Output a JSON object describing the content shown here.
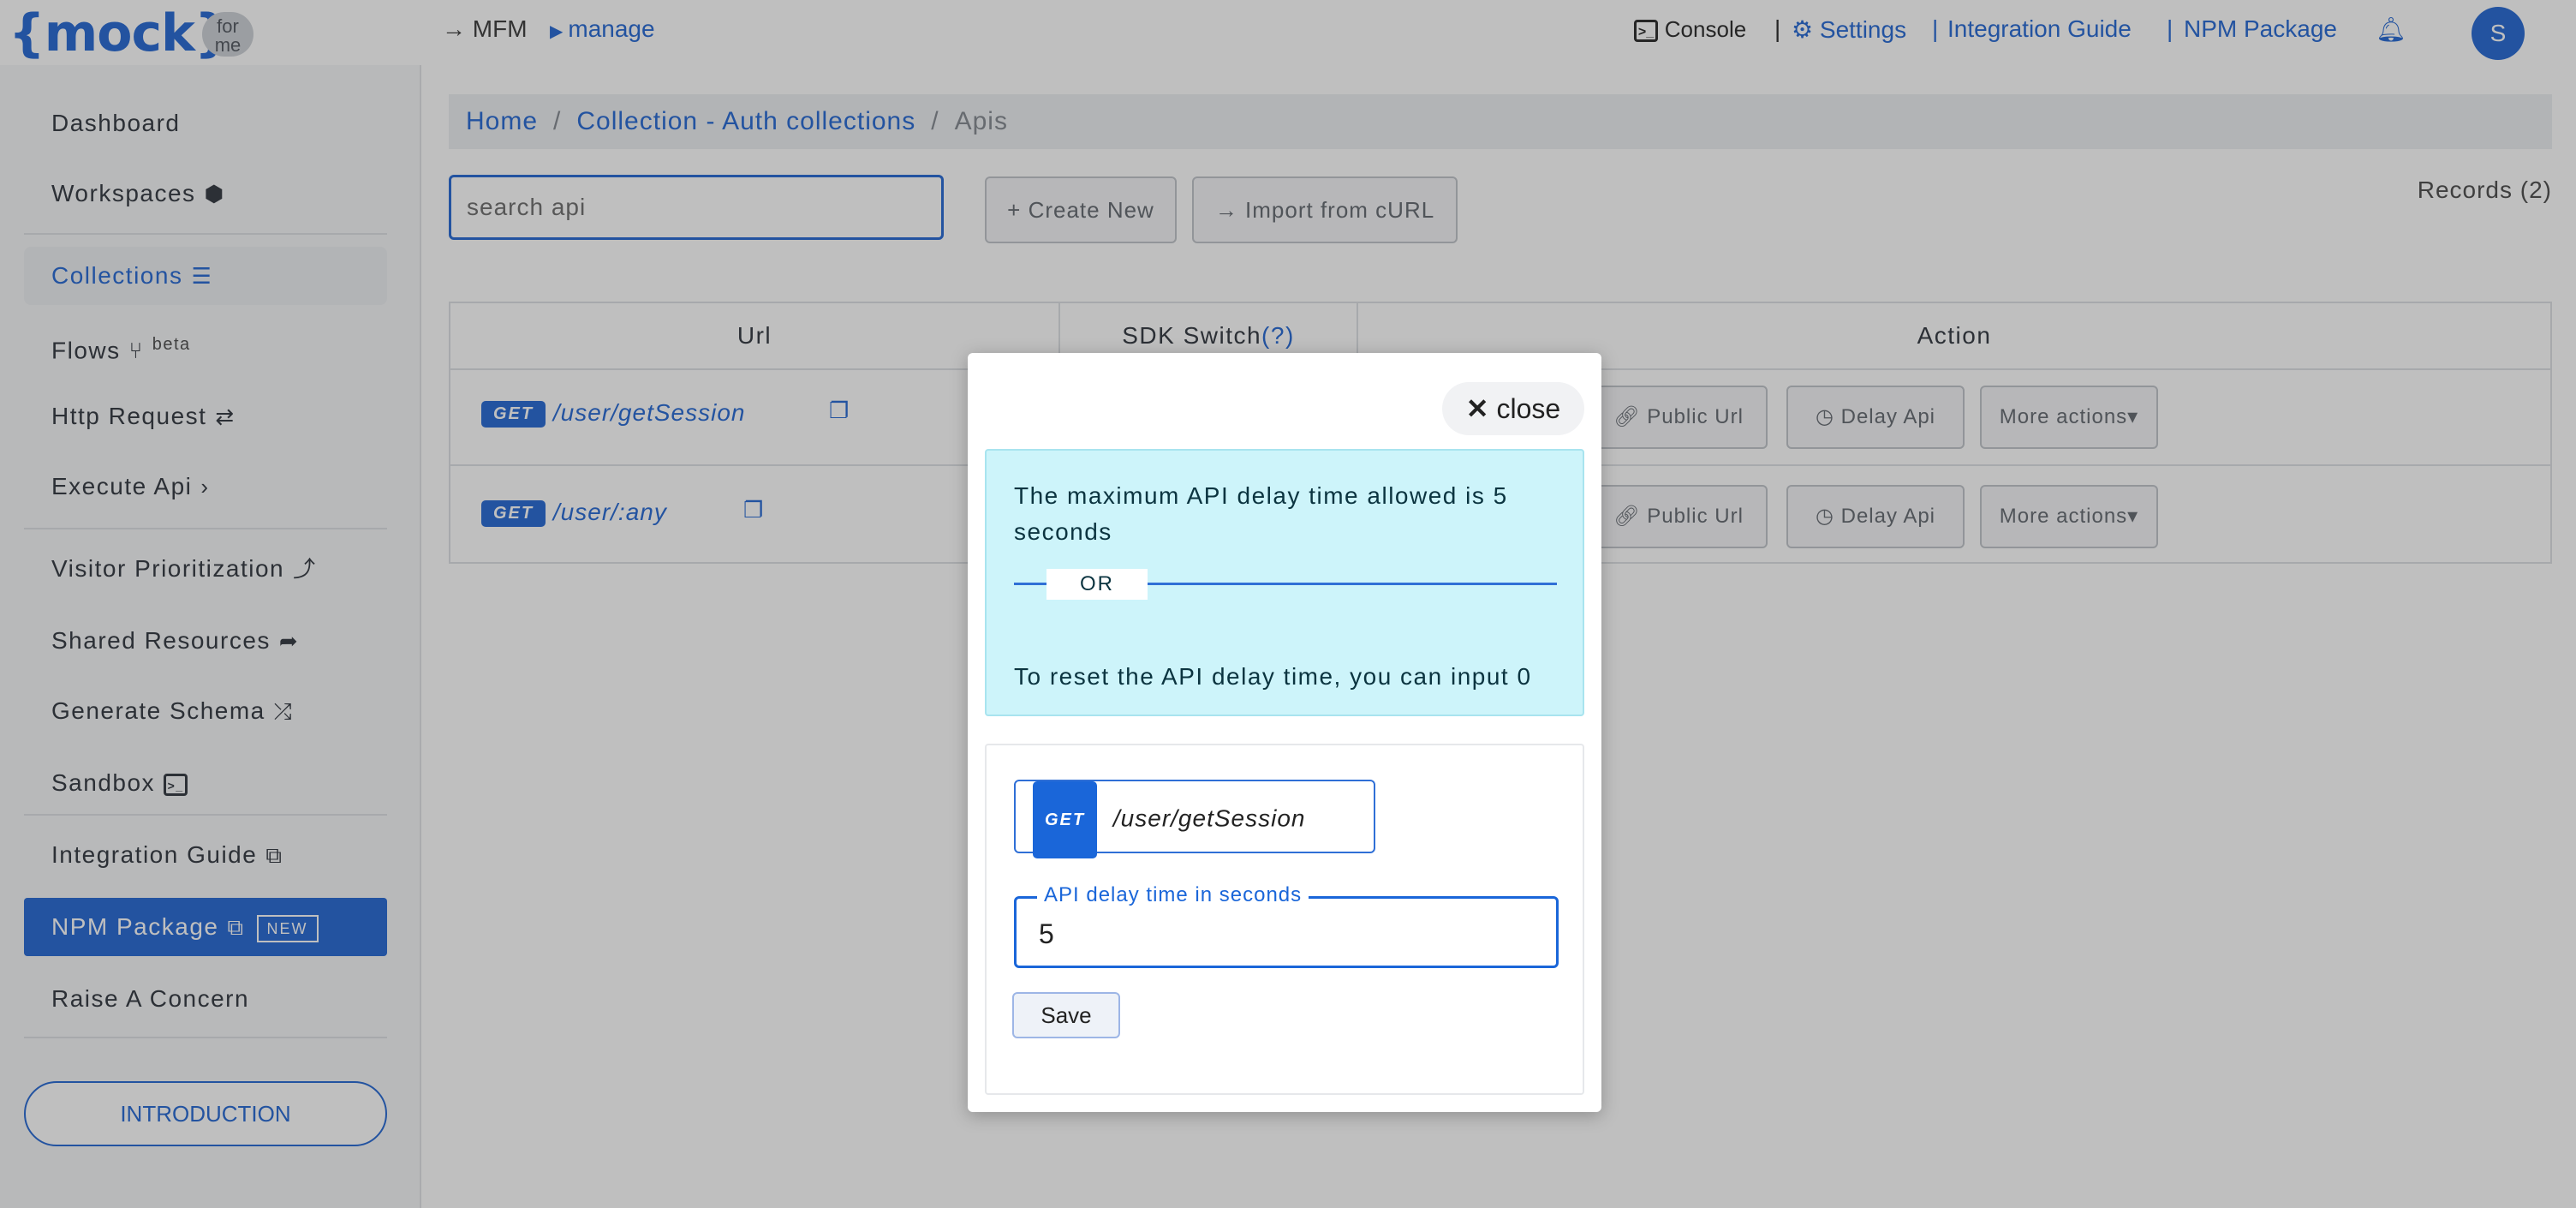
{
  "header": {
    "logo_text": "{mock}",
    "logo_badge": "for me",
    "mfm": "→ MFM",
    "manage": "manage",
    "console": "Console",
    "settings": "Settings",
    "integration_guide": "Integration Guide",
    "npm_package": "NPM Package",
    "avatar_letter": "S",
    "accent_color": "#2f6fd6"
  },
  "sidebar": {
    "items": [
      {
        "label": "Dashboard"
      },
      {
        "label": "Workspaces"
      },
      {
        "label": "Collections"
      },
      {
        "label": "Flows",
        "badge": "beta"
      },
      {
        "label": "Http Request"
      },
      {
        "label": "Execute Api"
      },
      {
        "label": "Visitor Prioritization"
      },
      {
        "label": "Shared Resources"
      },
      {
        "label": "Generate Schema"
      },
      {
        "label": "Sandbox"
      },
      {
        "label": "Integration Guide"
      },
      {
        "label": "NPM Package",
        "badge": "NEW"
      },
      {
        "label": "Raise A Concern"
      }
    ],
    "intro_button": "INTRODUCTION"
  },
  "breadcrumb": {
    "home": "Home",
    "collection": "Collection - Auth collections",
    "current": "Apis"
  },
  "toolbar": {
    "search_placeholder": "search api",
    "create_new": "+ Create New",
    "import_curl": "→ Import from cURL",
    "records": "Records (2)"
  },
  "table": {
    "headers": {
      "url": "Url",
      "sdk_switch": "SDK Switch",
      "sdk_help": "(?)",
      "action": "Action"
    },
    "rows": [
      {
        "method": "GET",
        "path": "/user/getSession"
      },
      {
        "method": "GET",
        "path": "/user/:any"
      }
    ],
    "actions": {
      "public_url": "Public Url",
      "delay_api": "Delay Api",
      "more_actions": "More actions"
    }
  },
  "modal": {
    "close_label": "close",
    "info_line1": "The maximum API delay time allowed is 5 seconds",
    "or_text": "OR",
    "info_line2": "To reset the API delay time, you can input 0",
    "api_method": "GET",
    "api_path": "/user/getSession",
    "field_label": "API delay time in seconds",
    "field_value": "5",
    "save_label": "Save"
  }
}
